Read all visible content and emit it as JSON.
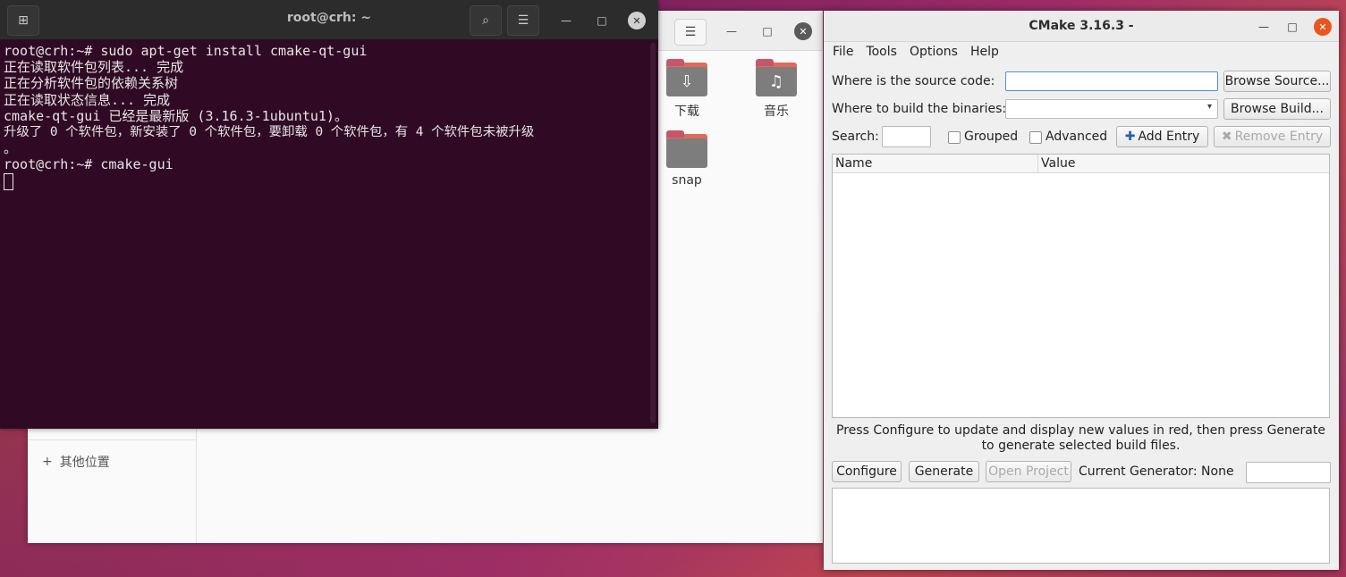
{
  "file_manager": {
    "folders": [
      {
        "label": "下载",
        "icon": "download-icon"
      },
      {
        "label": "音乐",
        "icon": "music-icon"
      },
      {
        "label": "snap",
        "icon": "folder-icon"
      }
    ],
    "sidebar_other": "其他位置"
  },
  "terminal": {
    "title": "root@crh: ~",
    "lines": [
      "root@crh:~# sudo apt-get install cmake-qt-gui",
      "正在读取软件包列表... 完成",
      "正在分析软件包的依赖关系树",
      "正在读取状态信息... 完成",
      "cmake-qt-gui 已经是最新版 (3.16.3-1ubuntu1)。",
      "升级了 0 个软件包，新安装了 0 个软件包，要卸载 0 个软件包，有 4 个软件包未被升级",
      "。",
      "root@crh:~# cmake-gui"
    ]
  },
  "cmake": {
    "title": "CMake 3.16.3 -",
    "menu": [
      "File",
      "Tools",
      "Options",
      "Help"
    ],
    "source_label": "Where is the source code:",
    "build_label": "Where to build the binaries:",
    "browse_source": "Browse Source...",
    "browse_build": "Browse Build...",
    "search_label": "Search:",
    "grouped": "Grouped",
    "advanced": "Advanced",
    "add_entry": "Add Entry",
    "remove_entry": "Remove Entry",
    "col_name": "Name",
    "col_value": "Value",
    "note": "Press Configure to update and display new values in red, then press Generate to generate selected build files.",
    "configure": "Configure",
    "generate": "Generate",
    "open_project": "Open Project",
    "current_generator": "Current Generator: None"
  }
}
